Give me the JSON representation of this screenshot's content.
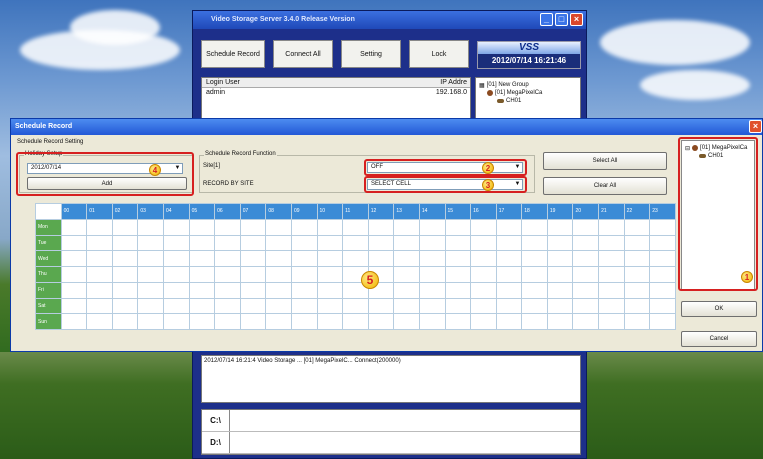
{
  "vss": {
    "title": "Video Storage Server 3.4.0 Release Version",
    "toolbar": [
      "Schedule Record",
      "Connect All",
      "Setting",
      "Lock"
    ],
    "logo": "VSS",
    "datetime": "2012/07/14 16:21:46",
    "login_header": "Login User",
    "ip_header": "IP Addre",
    "login_user": "admin",
    "login_ip": "192.168.0",
    "tree_group": "[01] New Group",
    "tree_cam": "[01] MegaPixelCa",
    "tree_ch": "CH01",
    "log_text": "2012/07/14 16:21:4    Video Storage ...    [01] MegaPixelC...    Connect(200000)",
    "drives": [
      "C:\\",
      "D:\\"
    ]
  },
  "dialog": {
    "title": "Schedule Record",
    "setting_label": "Schedule Record Setting",
    "holiday_caption": "Holiday Setup",
    "holiday_date": "2012/07/14",
    "add_label": "Add",
    "function_caption": "Schedule Record Function",
    "site_label": "Site[1]",
    "record_by_site": "RECORD BY SITE",
    "off_value": "OFF",
    "select_cell_value": "SELECT CELL",
    "select_all": "Select All",
    "clear_all": "Clear All",
    "ok": "OK",
    "cancel": "Cancel",
    "tree_cam": "[01] MegaPixelCa",
    "tree_ch": "CH01"
  },
  "grid": {
    "hours": [
      "00",
      "01",
      "02",
      "03",
      "04",
      "05",
      "06",
      "07",
      "08",
      "09",
      "10",
      "11",
      "12",
      "13",
      "14",
      "15",
      "16",
      "17",
      "18",
      "19",
      "20",
      "21",
      "22",
      "23"
    ],
    "days": [
      "Mon",
      "Tue",
      "Wed",
      "Thu",
      "Fri",
      "Sat",
      "Sun"
    ]
  },
  "badges": [
    "1",
    "2",
    "3",
    "4",
    "5"
  ],
  "colors": {
    "grid_header": "#3b8bd6",
    "day_cells": "#5aa84f",
    "highlight": "#d62020"
  }
}
